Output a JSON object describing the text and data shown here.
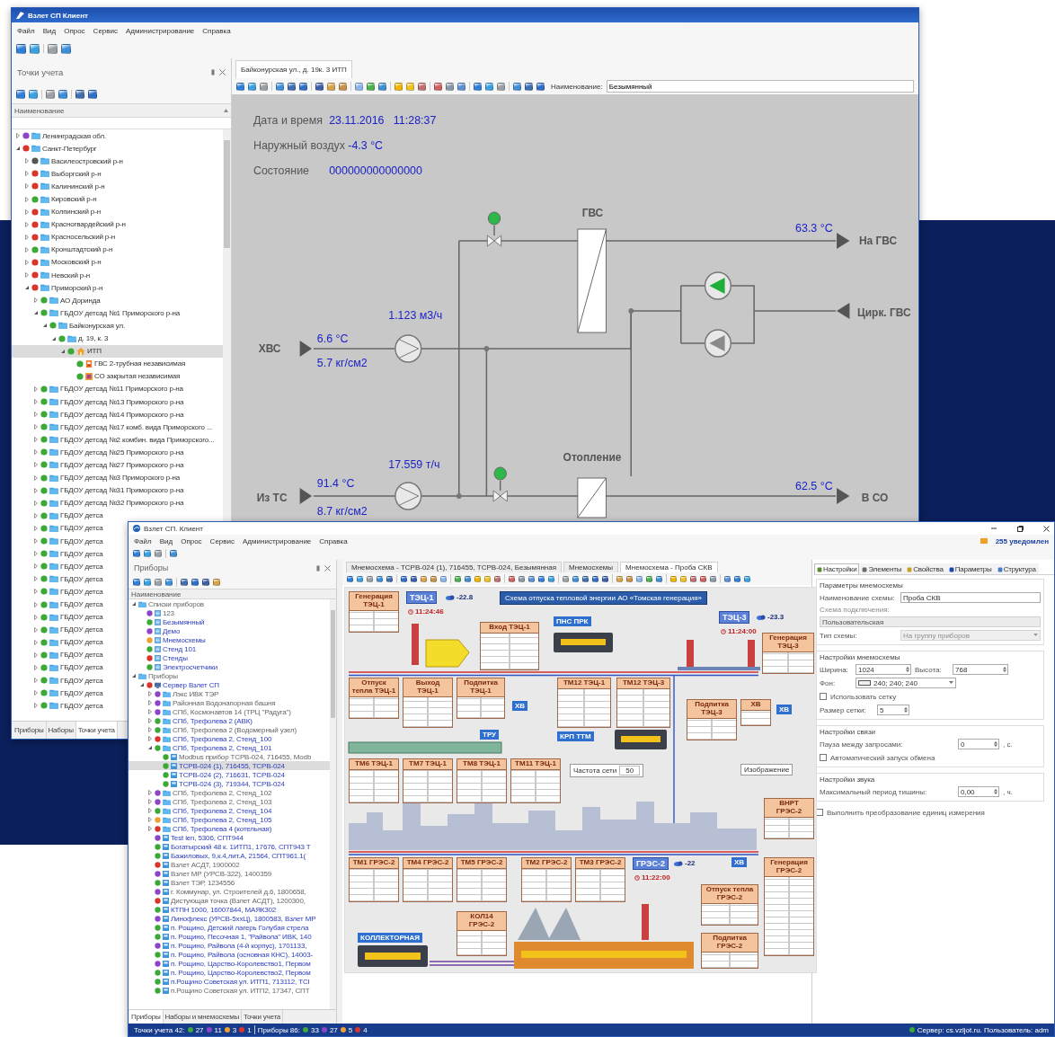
{
  "back_window": {
    "title": "Взлет СП Клиент",
    "menu": [
      "Файл",
      "Вид",
      "Опрос",
      "Сервис",
      "Администрирование",
      "Справка"
    ],
    "panel": {
      "title": "Точки учета",
      "column": "Наименование",
      "tree": [
        {
          "label": "Ленинградская обл.",
          "color": "#8e44c9",
          "kind": "folder",
          "expanded": false,
          "selected": false
        },
        {
          "label": "Санкт-Петербург",
          "color": "#d9362b",
          "kind": "folder",
          "expanded": true,
          "selected": false,
          "children": [
            {
              "label": "Василеостровский р-н",
              "color": "#555555",
              "kind": "folder",
              "expanded": false,
              "selected": false
            },
            {
              "label": "Выборгский р-н",
              "color": "#d9362b",
              "kind": "folder",
              "expanded": false,
              "selected": false
            },
            {
              "label": "Калининский р-н",
              "color": "#d9362b",
              "kind": "folder",
              "expanded": false,
              "selected": false
            },
            {
              "label": "Кировский р-н",
              "color": "#3aa935",
              "kind": "folder",
              "expanded": false,
              "selected": false
            },
            {
              "label": "Колпинский р-н",
              "color": "#d9362b",
              "kind": "folder",
              "expanded": false,
              "selected": false
            },
            {
              "label": "Красногвардейский р-н",
              "color": "#d9362b",
              "kind": "folder",
              "expanded": false,
              "selected": false
            },
            {
              "label": "Красносельский р-н",
              "color": "#d9362b",
              "kind": "folder",
              "expanded": false,
              "selected": false
            },
            {
              "label": "Кронштадтский р-н",
              "color": "#3aa935",
              "kind": "folder",
              "expanded": false,
              "selected": false
            },
            {
              "label": "Московский р-н",
              "color": "#d9362b",
              "kind": "folder",
              "expanded": false,
              "selected": false
            },
            {
              "label": "Невский р-н",
              "color": "#d9362b",
              "kind": "folder",
              "expanded": false,
              "selected": false
            },
            {
              "label": "Приморский р-н",
              "color": "#d9362b",
              "kind": "folder",
              "expanded": true,
              "selected": false,
              "children": [
                {
                  "label": "АО Доринда",
                  "color": "#3aa935",
                  "kind": "folder",
                  "expanded": false,
                  "selected": false
                },
                {
                  "label": "ГБДОУ детсад №1 Приморского р-на",
                  "color": "#3aa935",
                  "kind": "folder",
                  "expanded": true,
                  "selected": false,
                  "children": [
                    {
                      "label": "Байконурская ул.",
                      "color": "#3aa935",
                      "kind": "folder",
                      "expanded": true,
                      "selected": false,
                      "children": [
                        {
                          "label": "д. 19, к. 3",
                          "color": "#3aa935",
                          "kind": "folder",
                          "expanded": true,
                          "selected": false,
                          "children": [
                            {
                              "label": "ИТП",
                              "color": "#3aa935",
                              "kind": "house",
                              "expanded": true,
                              "selected": true,
                              "children": [
                                {
                                  "label": "ГВС 2-трубная независимая",
                                  "color": "#3aa935",
                                  "kind": "hot-water",
                                  "selected": false
                                },
                                {
                                  "label": "СО закрытая независимая",
                                  "color": "#3aa935",
                                  "kind": "heating",
                                  "selected": false
                                }
                              ]
                            }
                          ]
                        }
                      ]
                    }
                  ]
                },
                {
                  "label": "ГБДОУ детсад №11 Приморского р-на",
                  "color": "#3aa935",
                  "kind": "folder",
                  "expanded": false,
                  "selected": false
                },
                {
                  "label": "ГБДОУ детсад №13 Приморского р-на",
                  "color": "#3aa935",
                  "kind": "folder",
                  "expanded": false,
                  "selected": false
                },
                {
                  "label": "ГБДОУ детсад №14 Приморского р-на",
                  "color": "#3aa935",
                  "kind": "folder",
                  "expanded": false,
                  "selected": false
                },
                {
                  "label": "ГБДОУ детсад №17 комб. вида Приморского ...",
                  "color": "#3aa935",
                  "kind": "folder",
                  "expanded": false,
                  "selected": false
                },
                {
                  "label": "ГБДОУ детсад №2 комбин. вида Приморского...",
                  "color": "#3aa935",
                  "kind": "folder",
                  "expanded": false,
                  "selected": false
                },
                {
                  "label": "ГБДОУ детсад №25 Приморского р-на",
                  "color": "#3aa935",
                  "kind": "folder",
                  "expanded": false,
                  "selected": false
                },
                {
                  "label": "ГБДОУ детсад №27 Приморского р-на",
                  "color": "#3aa935",
                  "kind": "folder",
                  "expanded": false,
                  "selected": false
                },
                {
                  "label": "ГБДОУ детсад №3 Приморского р-на",
                  "color": "#3aa935",
                  "kind": "folder",
                  "expanded": false,
                  "selected": false
                },
                {
                  "label": "ГБДОУ детсад №31 Приморского р-на",
                  "color": "#3aa935",
                  "kind": "folder",
                  "expanded": false,
                  "selected": false
                },
                {
                  "label": "ГБДОУ детсад №32 Приморского р-на",
                  "color": "#3aa935",
                  "kind": "folder",
                  "expanded": false,
                  "selected": false
                },
                {
                  "label": "ГБДОУ детса",
                  "color": "#3aa935",
                  "kind": "folder",
                  "expanded": false,
                  "selected": false
                },
                {
                  "label": "ГБДОУ детса",
                  "color": "#3aa935",
                  "kind": "folder",
                  "expanded": false,
                  "selected": false
                },
                {
                  "label": "ГБДОУ детса",
                  "color": "#3aa935",
                  "kind": "folder",
                  "expanded": false,
                  "selected": false
                },
                {
                  "label": "ГБДОУ детса",
                  "color": "#3aa935",
                  "kind": "folder",
                  "expanded": false,
                  "selected": false
                },
                {
                  "label": "ГБДОУ детса",
                  "color": "#3aa935",
                  "kind": "folder",
                  "expanded": false,
                  "selected": false
                },
                {
                  "label": "ГБДОУ детса",
                  "color": "#3aa935",
                  "kind": "folder",
                  "expanded": false,
                  "selected": false
                },
                {
                  "label": "ГБДОУ детса",
                  "color": "#3aa935",
                  "kind": "folder",
                  "expanded": false,
                  "selected": false
                },
                {
                  "label": "ГБДОУ детса",
                  "color": "#3aa935",
                  "kind": "folder",
                  "expanded": false,
                  "selected": false
                },
                {
                  "label": "ГБДОУ детса",
                  "color": "#3aa935",
                  "kind": "folder",
                  "expanded": false,
                  "selected": false
                },
                {
                  "label": "ГБДОУ детса",
                  "color": "#3aa935",
                  "kind": "folder",
                  "expanded": false,
                  "selected": false
                },
                {
                  "label": "ГБДОУ детса",
                  "color": "#3aa935",
                  "kind": "folder",
                  "expanded": false,
                  "selected": false
                },
                {
                  "label": "ГБДОУ детса",
                  "color": "#3aa935",
                  "kind": "folder",
                  "expanded": false,
                  "selected": false
                },
                {
                  "label": "ГБДОУ детса",
                  "color": "#3aa935",
                  "kind": "folder",
                  "expanded": false,
                  "selected": false
                },
                {
                  "label": "ГБДОУ детса",
                  "color": "#3aa935",
                  "kind": "folder",
                  "expanded": false,
                  "selected": false
                },
                {
                  "label": "ГБДОУ детса",
                  "color": "#3aa935",
                  "kind": "folder",
                  "expanded": false,
                  "selected": false
                },
                {
                  "label": "ГБДОУ детса",
                  "color": "#3aa935",
                  "kind": "folder",
                  "expanded": false,
                  "selected": false
                }
              ]
            }
          ]
        }
      ],
      "bottom_tabs": [
        {
          "label": "Приборы",
          "selected": false
        },
        {
          "label": "Наборы",
          "selected": false
        },
        {
          "label": "Точки учета",
          "selected": true
        }
      ]
    },
    "document": {
      "tab": "Байконурская ул., д. 19к. 3 ИТП",
      "name_label": "Наименование:",
      "name_value": "Безымянный",
      "info": [
        {
          "label": "Дата и время",
          "values": [
            "23.11.2016",
            "11:28:37"
          ]
        },
        {
          "label": "Наружный воздух",
          "values": [
            "-4.3 °C"
          ]
        },
        {
          "label": "Состояние",
          "values": [
            "000000000000000"
          ]
        }
      ],
      "scheme": {
        "labels": [
          {
            "kind": "name",
            "text": "ГВС"
          },
          {
            "kind": "value",
            "text": "63.3 °C"
          },
          {
            "kind": "name",
            "text": "На ГВС"
          },
          {
            "kind": "name",
            "text": "Цирк. ГВС"
          },
          {
            "kind": "value",
            "text": "1.123 м3/ч"
          },
          {
            "kind": "name",
            "text": "ХВС"
          },
          {
            "kind": "value",
            "text": "6.6 °C"
          },
          {
            "kind": "value",
            "text": "5.7 кг/см2"
          },
          {
            "kind": "value",
            "text": "17.559 т/ч"
          },
          {
            "kind": "name",
            "text": "Отопление"
          },
          {
            "kind": "value",
            "text": "62.5 °C"
          },
          {
            "kind": "name",
            "text": "Из ТС"
          },
          {
            "kind": "value",
            "text": "91.4 °C"
          },
          {
            "kind": "value",
            "text": "8.7 кг/см2"
          },
          {
            "kind": "name",
            "text": "В СО"
          }
        ],
        "valves": [
          {
            "open": true
          },
          {
            "open": true
          }
        ],
        "pumps": [
          {
            "running": true
          },
          {
            "running": false
          }
        ]
      }
    }
  },
  "front_window": {
    "title": "Взлет СП. Клиент",
    "menu": [
      "Файл",
      "Вид",
      "Опрос",
      "Сервис",
      "Администрирование",
      "Справка"
    ],
    "notifications": "255 уведомлен",
    "panel": {
      "title": "Приборы",
      "column": "Наименование",
      "tree": [
        {
          "label": "Списки приборов",
          "kind": "folder",
          "expanded": true,
          "selected": false,
          "active": false,
          "children": [
            {
              "label": "123",
              "color": "#8e44c9",
              "kind": "list",
              "selected": false,
              "active": false
            },
            {
              "label": "Безымянный",
              "color": "#3aa935",
              "kind": "list",
              "selected": false,
              "active": true
            },
            {
              "label": "Демо",
              "color": "#8e44c9",
              "kind": "list",
              "selected": false,
              "active": true
            },
            {
              "label": "Мнемосхемы",
              "color": "#f0a030",
              "kind": "list",
              "selected": false,
              "active": true
            },
            {
              "label": "Стенд 101",
              "color": "#3aa935",
              "kind": "list",
              "selected": false,
              "active": true
            },
            {
              "label": "Стенды",
              "color": "#d9362b",
              "kind": "list",
              "selected": false,
              "active": true
            },
            {
              "label": "Электросчетчики",
              "color": "#3aa935",
              "kind": "list",
              "selected": false,
              "active": true
            }
          ]
        },
        {
          "label": "Приборы",
          "kind": "folder",
          "expanded": true,
          "selected": false,
          "active": false,
          "children": [
            {
              "label": "Сервер Взлет СП",
              "color": "#d9362b",
              "kind": "server",
              "expanded": true,
              "selected": false,
              "active": true,
              "children": [
                {
                  "label": "Лэкс ИВК ТЭР",
                  "color": "#8e44c9",
                  "kind": "folder",
                  "expanded": false,
                  "selected": false,
                  "active": false
                },
                {
                  "label": "Районная Водонапорная башня",
                  "color": "#8e44c9",
                  "kind": "folder",
                  "expanded": false,
                  "selected": false,
                  "active": false
                },
                {
                  "label": "СПб, Космонавтов 14 (ТРЦ \"Радуга\")",
                  "color": "#8e44c9",
                  "kind": "folder",
                  "expanded": false,
                  "selected": false,
                  "active": false
                },
                {
                  "label": "СПб, Трефолева 2 (АВК)",
                  "color": "#3aa935",
                  "kind": "folder",
                  "expanded": false,
                  "selected": false,
                  "active": true
                },
                {
                  "label": "СПб, Трефолева 2 (Водомерный узел)",
                  "color": "#3aa935",
                  "kind": "folder",
                  "expanded": false,
                  "selected": false,
                  "active": false
                },
                {
                  "label": "СПб, Трефолева 2, Стенд_100",
                  "color": "#d9362b",
                  "kind": "folder",
                  "expanded": false,
                  "selected": false,
                  "active": true
                },
                {
                  "label": "СПб, Трефолева 2, Стенд_101",
                  "color": "#3aa935",
                  "kind": "folder",
                  "expanded": true,
                  "selected": false,
                  "active": true,
                  "children": [
                    {
                      "label": "Modbus прибор ТСРВ-024, 716455, Modb",
                      "color": "#3aa935",
                      "kind": "device",
                      "selected": false,
                      "active": false
                    },
                    {
                      "label": "ТСРВ-024 (1), 716455, ТСРВ-024",
                      "color": "#3aa935",
                      "kind": "device",
                      "selected": true,
                      "active": true
                    },
                    {
                      "label": "ТСРВ-024 (2), 716631, ТСРВ-024",
                      "color": "#3aa935",
                      "kind": "device",
                      "selected": false,
                      "active": true
                    },
                    {
                      "label": "ТСРВ-024 (3), 719344, ТСРВ-024",
                      "color": "#3aa935",
                      "kind": "device",
                      "selected": false,
                      "active": true
                    }
                  ]
                },
                {
                  "label": "СПб, Трефолева 2, Стенд_102",
                  "color": "#8e44c9",
                  "kind": "folder",
                  "expanded": false,
                  "selected": false,
                  "active": false
                },
                {
                  "label": "СПб, Трефолева 2, Стенд_103",
                  "color": "#8e44c9",
                  "kind": "folder",
                  "expanded": false,
                  "selected": false,
                  "active": false
                },
                {
                  "label": "СПб, Трефолева 2, Стенд_104",
                  "color": "#3aa935",
                  "kind": "folder",
                  "expanded": false,
                  "selected": false,
                  "active": true
                },
                {
                  "label": "СПб, Трефолева 2, Стенд_105",
                  "color": "#f0a030",
                  "kind": "folder",
                  "expanded": false,
                  "selected": false,
                  "active": true
                },
                {
                  "label": "СПб, Трефолева 4 (котельная)",
                  "color": "#d9362b",
                  "kind": "folder",
                  "expanded": false,
                  "selected": false,
                  "active": true
                },
                {
                  "label": "Test len, 5306, СПТ944",
                  "color": "#8e44c9",
                  "kind": "device",
                  "selected": false,
                  "active": true
                },
                {
                  "label": "Богатырский 48 к. 1ИТП1, 17676, СПТ943 Т",
                  "color": "#3aa935",
                  "kind": "device",
                  "selected": false,
                  "active": true
                },
                {
                  "label": "Бажиловых, 9,к.4,лит.А, 21564, СПТ961.1(",
                  "color": "#3aa935",
                  "kind": "device",
                  "selected": false,
                  "active": true
                },
                {
                  "label": "Взлет АСДТ, 1900002",
                  "color": "#d9362b",
                  "kind": "device",
                  "selected": false,
                  "active": false
                },
                {
                  "label": "Взлет МР (УРСВ-322), 1400359",
                  "color": "#8e44c9",
                  "kind": "device",
                  "selected": false,
                  "active": false
                },
                {
                  "label": "Взлет ТЭР, 1234556",
                  "color": "#3aa935",
                  "kind": "device",
                  "selected": false,
                  "active": false
                },
                {
                  "label": "г. Коммунар, ул. Строителей д.6, 1800658,",
                  "color": "#8e44c9",
                  "kind": "device",
                  "selected": false,
                  "active": false
                },
                {
                  "label": "Дистующая точка (Взлет АСДТ), 1200300,",
                  "color": "#d9362b",
                  "kind": "device",
                  "selected": false,
                  "active": false
                },
                {
                  "label": "КТПН 1000, 16007844, МАЯК302",
                  "color": "#3aa935",
                  "kind": "device",
                  "selected": false,
                  "active": true
                },
                {
                  "label": "Линофлекс (УРСВ-5ххЦ), 1800583, Взлет МР",
                  "color": "#8e44c9",
                  "kind": "device",
                  "selected": false,
                  "active": true
                },
                {
                  "label": "п. Рощино, Детский лагерь Голубая стрела",
                  "color": "#3aa935",
                  "kind": "device",
                  "selected": false,
                  "active": true
                },
                {
                  "label": "п. Рощино, Песочная 1, \"Райвола\" ИВК, 140",
                  "color": "#3aa935",
                  "kind": "device",
                  "selected": false,
                  "active": true
                },
                {
                  "label": "п. Рощино, Райвола (4-й корпус), 1701133,",
                  "color": "#8e44c9",
                  "kind": "device",
                  "selected": false,
                  "active": true
                },
                {
                  "label": "п. Рощино, Райвола (основная КНС), 14003-",
                  "color": "#3aa935",
                  "kind": "device",
                  "selected": false,
                  "active": true
                },
                {
                  "label": "п. Рощино, Царство-Королевство1, Первом",
                  "color": "#8e44c9",
                  "kind": "device",
                  "selected": false,
                  "active": true
                },
                {
                  "label": "п. Рощино, Царство-Королевство2, Первом",
                  "color": "#3aa935",
                  "kind": "device",
                  "selected": false,
                  "active": true
                },
                {
                  "label": "п.Рощино Советская ул. ИТП1, 713112, ТСI",
                  "color": "#3aa935",
                  "kind": "device",
                  "selected": false,
                  "active": true
                },
                {
                  "label": "п.Рощино Советская ул. ИТП2, 17347, СПТ",
                  "color": "#3aa935",
                  "kind": "device",
                  "selected": false,
                  "active": false
                }
              ]
            }
          ]
        }
      ],
      "bottom_tabs": [
        {
          "label": "Приборы",
          "selected": true
        },
        {
          "label": "Наборы и мнемосхемы",
          "selected": false
        },
        {
          "label": "Точки учета",
          "selected": false
        }
      ]
    },
    "tabs": [
      {
        "label": "Мнемосхема - ТСРВ-024 (1), 716455, ТСРВ-024, Безымянная",
        "selected": false
      },
      {
        "label": "Мнемосхемы",
        "selected": false
      },
      {
        "label": "Мнемосхема - Проба СКВ",
        "selected": true
      }
    ],
    "scheme": {
      "labels": [
        {
          "kind": "table",
          "text": "Генерация ТЭЦ-1"
        },
        {
          "kind": "station",
          "text": "ТЭЦ-1"
        },
        {
          "kind": "temp",
          "text": "-22.8"
        },
        {
          "kind": "banner",
          "text": "Схема отпуска тепловой энергии АО «Томская генерация»"
        },
        {
          "kind": "time",
          "text": "11:24:46"
        },
        {
          "kind": "station",
          "text": "ТЭЦ-3"
        },
        {
          "kind": "temp",
          "text": "-23.3"
        },
        {
          "kind": "tag",
          "text": "ПНС ПРК"
        },
        {
          "kind": "table",
          "text": "Вход ТЭЦ-1"
        },
        {
          "kind": "time",
          "text": "11:24:00"
        },
        {
          "kind": "table",
          "text": "Генерация ТЭЦ-3"
        },
        {
          "kind": "table",
          "text": "Отпуск тепла ТЭЦ-1"
        },
        {
          "kind": "table",
          "text": "Выход ТЭЦ-1"
        },
        {
          "kind": "table",
          "text": "Подпитка ТЭЦ-1"
        },
        {
          "kind": "table",
          "text": "ТМ12 ТЭЦ-1"
        },
        {
          "kind": "table",
          "text": "ТМ12 ТЭЦ-3"
        },
        {
          "kind": "tag",
          "text": "ХВ"
        },
        {
          "kind": "table",
          "text": "Подпитка ТЭЦ-3"
        },
        {
          "kind": "table",
          "text": "ХВ"
        },
        {
          "kind": "tag",
          "text": "ХВ"
        },
        {
          "kind": "tag",
          "text": "ТРУ"
        },
        {
          "kind": "tag",
          "text": "КРП ТТМ"
        },
        {
          "kind": "table",
          "text": "ТМ6 ТЭЦ-1"
        },
        {
          "kind": "table",
          "text": "ТМ7 ТЭЦ-1"
        },
        {
          "kind": "table",
          "text": "ТМ8 ТЭЦ-1"
        },
        {
          "kind": "table",
          "text": "ТМ11 ТЭЦ-1"
        },
        {
          "kind": "plain",
          "text": "Частота сети",
          "value": "50"
        },
        {
          "kind": "plain",
          "text": "Изображение"
        },
        {
          "kind": "table",
          "text": "ВНРТ ГРЭС-2"
        },
        {
          "kind": "table",
          "text": "ТМ1 ГРЭС-2"
        },
        {
          "kind": "table",
          "text": "ТМ4 ГРЭС-2"
        },
        {
          "kind": "table",
          "text": "ТМ5 ГРЭС-2"
        },
        {
          "kind": "table",
          "text": "ТМ2 ГРЭС-2"
        },
        {
          "kind": "table",
          "text": "ТМ3 ГРЭС-2"
        },
        {
          "kind": "station",
          "text": "ГРЭС-2"
        },
        {
          "kind": "temp",
          "text": "-22"
        },
        {
          "kind": "tag",
          "text": "ХВ"
        },
        {
          "kind": "table",
          "text": "Генерация ГРЭС-2"
        },
        {
          "kind": "time",
          "text": "11:22:00"
        },
        {
          "kind": "table",
          "text": "Отпуск тепла ГРЭС-2"
        },
        {
          "kind": "table",
          "text": "КОЛ14 ГРЭС-2"
        },
        {
          "kind": "tag",
          "text": "КОЛЛЕКТОРНАЯ"
        },
        {
          "kind": "table",
          "text": "Подпитка ГРЭС-2"
        }
      ]
    },
    "settings": {
      "tabs": [
        {
          "label": "Настройки",
          "selected": true
        },
        {
          "label": "Элементы",
          "selected": false
        },
        {
          "label": "Свойства",
          "selected": false
        },
        {
          "label": "Параметры",
          "selected": false
        },
        {
          "label": "Структура",
          "selected": false
        }
      ],
      "groups": [
        {
          "title": "Параметры мнемосхемы",
          "rows": [
            {
              "kind": "field",
              "label": "Наименование схемы:",
              "value": "Проба СКВ",
              "disabled": false
            },
            {
              "kind": "stacked",
              "label": "Схема подключения:",
              "value": "Пользовательская",
              "disabled": true
            },
            {
              "kind": "select",
              "label": "Тип схемы:",
              "value": "На группу приборов",
              "disabled": true
            }
          ]
        },
        {
          "title": "Настройки мнемосхемы",
          "rows": [
            {
              "kind": "spin-pair",
              "label": "Ширина:",
              "value": "1024",
              "label2": "Высота:",
              "value2": "768"
            },
            {
              "kind": "color",
              "label": "Фон:",
              "value": "240; 240; 240",
              "color": "#f0f0f0"
            },
            {
              "kind": "check",
              "label": "Использовать сетку",
              "checked": false
            },
            {
              "kind": "spin",
              "label": "Размер сетки:",
              "value": "5"
            }
          ]
        },
        {
          "title": "Настройки связи",
          "rows": [
            {
              "kind": "spin",
              "label": "Пауза между запросами:",
              "value": "0",
              "unit": ", с."
            },
            {
              "kind": "check",
              "label": "Автоматический запуск обмена",
              "checked": false
            }
          ]
        },
        {
          "title": "Настройки звука",
          "rows": [
            {
              "kind": "spin",
              "label": "Максимальный период тишины:",
              "value": "0,00",
              "unit": ", ч."
            }
          ]
        }
      ],
      "extra_checks": [
        {
          "label": "Выполнить преобразование единиц измерения",
          "checked": false
        }
      ]
    },
    "status_bar": {
      "points_label": "Точки учета 42:",
      "points": [
        {
          "count": "27",
          "color": "#3aa935"
        },
        {
          "count": "11",
          "color": "#8e44c9"
        },
        {
          "count": "3",
          "color": "#f0a030"
        },
        {
          "count": "1",
          "color": "#d9362b"
        }
      ],
      "devices_label": "Приборы 86:",
      "devices": [
        {
          "count": "33",
          "color": "#3aa935"
        },
        {
          "count": "27",
          "color": "#8e44c9"
        },
        {
          "count": "5",
          "color": "#f0a030"
        },
        {
          "count": "4",
          "color": "#d9362b"
        }
      ],
      "connected": true,
      "server": "Сервер: cs.vzljot.ru. Пользователь: adm"
    }
  }
}
